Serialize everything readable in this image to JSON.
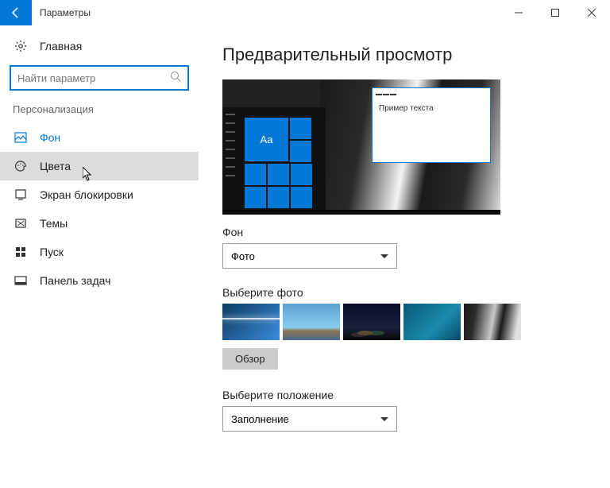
{
  "titlebar": {
    "title": "Параметры"
  },
  "sidebar": {
    "home": "Главная",
    "search_placeholder": "Найти параметр",
    "section": "Персонализация",
    "items": [
      {
        "label": "Фон"
      },
      {
        "label": "Цвета"
      },
      {
        "label": "Экран блокировки"
      },
      {
        "label": "Темы"
      },
      {
        "label": "Пуск"
      },
      {
        "label": "Панель задач"
      }
    ]
  },
  "main": {
    "heading": "Предварительный просмотр",
    "preview_tile_text": "Aa",
    "preview_window_text": "Пример текста",
    "background_label": "Фон",
    "background_value": "Фото",
    "choose_photo_label": "Выберите фото",
    "browse_button": "Обзор",
    "fit_label": "Выберите положение",
    "fit_value": "Заполнение"
  }
}
